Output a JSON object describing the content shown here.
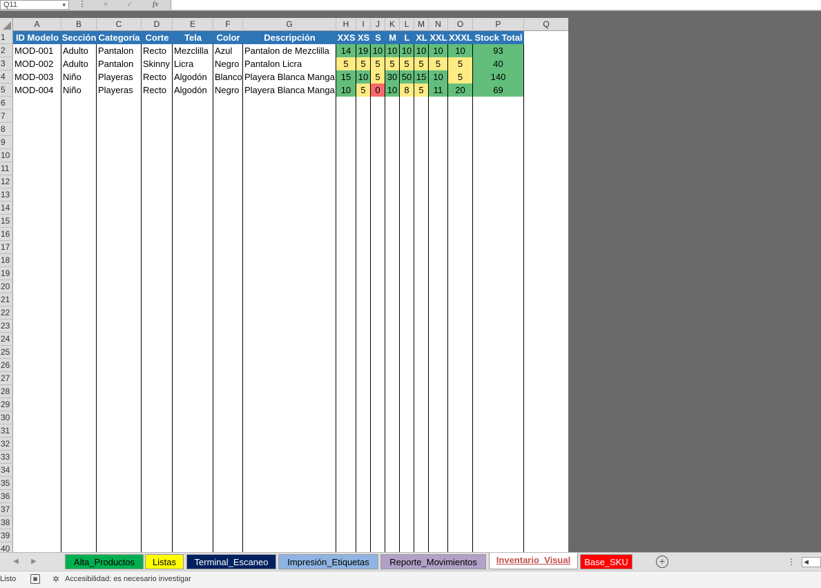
{
  "formula_bar": {
    "name_box": "Q11",
    "cancel_icon": "×",
    "enter_icon": "✓",
    "fx_label": "fx",
    "dots": "⋮",
    "formula": ""
  },
  "column_headers": [
    "A",
    "B",
    "C",
    "D",
    "E",
    "F",
    "G",
    "H",
    "I",
    "J",
    "K",
    "L",
    "M",
    "N",
    "O",
    "P",
    "Q"
  ],
  "row_headers": [
    "1",
    "2",
    "3",
    "4",
    "5",
    "6",
    "7",
    "8",
    "9",
    "10",
    "11",
    "12",
    "13",
    "14",
    "15",
    "16",
    "17",
    "18",
    "19",
    "20",
    "21",
    "22",
    "23",
    "24",
    "25",
    "26",
    "27",
    "28",
    "29",
    "30",
    "31",
    "32",
    "33",
    "34",
    "35",
    "36",
    "37",
    "38",
    "39",
    "40"
  ],
  "table": {
    "headers": [
      "ID Modelo",
      "Sección",
      "Categoría",
      "Corte",
      "Tela",
      "Color",
      "Descripción",
      "XXS",
      "XS",
      "S",
      "M",
      "L",
      "XL",
      "XXL",
      "XXXL",
      "Stock Total"
    ],
    "rows": [
      [
        "MOD-001",
        "Adulto",
        "Pantalon",
        "Recto",
        "Mezclilla",
        "Azul",
        "Pantalon de Mezclilla",
        "14",
        "19",
        "10",
        "10",
        "10",
        "10",
        "10",
        "10",
        "93"
      ],
      [
        "MOD-002",
        "Adulto",
        "Pantalon",
        "Skinny",
        "Licra",
        "Negro",
        "Pantalon Licra",
        "5",
        "5",
        "5",
        "5",
        "5",
        "5",
        "5",
        "5",
        "40"
      ],
      [
        "MOD-003",
        "Niño",
        "Playeras",
        "Recto",
        "Algodón",
        "Blanco",
        "Playera Blanca Manga",
        "15",
        "10",
        "5",
        "30",
        "50",
        "15",
        "10",
        "5",
        "140"
      ],
      [
        "MOD-004",
        "Niño",
        "Playeras",
        "Recto",
        "Algodón",
        "Negro",
        "Playera Blanca Manga",
        "10",
        "5",
        "0",
        "10",
        "8",
        "5",
        "11",
        "20",
        "69"
      ]
    ],
    "cell_colors": [
      [
        "green",
        "green",
        "green",
        "green",
        "green",
        "green",
        "green",
        "green",
        "green"
      ],
      [
        "yellow",
        "yellow",
        "yellow",
        "yellow",
        "yellow",
        "yellow",
        "yellow",
        "yellow",
        "yellow"
      ],
      [
        "green",
        "green",
        "yellow",
        "green",
        "green",
        "green",
        "green",
        "yellow",
        "green"
      ],
      [
        "green",
        "yellow",
        "red",
        "green",
        "yellow",
        "yellow",
        "green",
        "green",
        "green"
      ]
    ]
  },
  "colors": {
    "header_blue": "#2e75b6",
    "green": "#63be7b",
    "yellow": "#ffeb84",
    "red": "#f8696b"
  },
  "sheet_tabs": [
    {
      "label": "Alta_Productos",
      "bg": "#00b050",
      "fg": "#000000",
      "active": false
    },
    {
      "label": "Listas",
      "bg": "#ffff00",
      "fg": "#000000",
      "active": false
    },
    {
      "label": "Terminal_Escaneo",
      "bg": "#002060",
      "fg": "#ffffff",
      "active": false
    },
    {
      "label": "Impresión_Etiquetas",
      "bg": "#8eb4e3",
      "fg": "#000000",
      "active": false
    },
    {
      "label": "Reporte_Movimientos",
      "bg": "#b1a0c7",
      "fg": "#000000",
      "active": false
    },
    {
      "label": "Inventario_Visual",
      "bg": "#ffffff",
      "fg": "#c0504d",
      "active": true
    },
    {
      "label": "Base_SKU",
      "bg": "#ff0000",
      "fg": "#ffffff",
      "active": false
    }
  ],
  "tab_nav": {
    "prev": "◀",
    "next": "▶",
    "add": "+",
    "options": "⋮",
    "scroll_left": "◀"
  },
  "status_bar": {
    "ready": "Listo",
    "macro_icon": "▣",
    "accessibility_icon": "✲",
    "accessibility": "Accesibilidad: es necesario investigar"
  }
}
